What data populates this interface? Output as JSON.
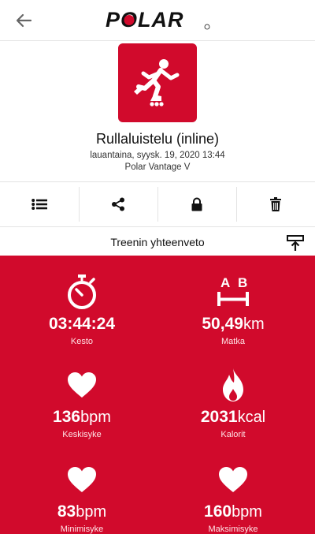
{
  "brand": {
    "logo_text": "POLAR"
  },
  "workout": {
    "sport": "Rullaluistelu (inline)",
    "date": "lauantaina, syysk. 19, 2020 13:44",
    "device": "Polar Vantage V"
  },
  "actions": [
    {
      "name": "list",
      "icon": "list-icon"
    },
    {
      "name": "share",
      "icon": "share-icon"
    },
    {
      "name": "privacy",
      "icon": "lock-icon"
    },
    {
      "name": "delete",
      "icon": "trash-icon"
    }
  ],
  "summary": {
    "title": "Treenin yhteenveto",
    "stats": {
      "duration": {
        "value": "03:44:24",
        "unit": "",
        "label": "Kesto",
        "icon": "stopwatch-icon"
      },
      "distance": {
        "value": "50,49",
        "unit": "km",
        "label": "Matka",
        "icon": "distance-ab-icon",
        "icon_letters": [
          "A",
          "B"
        ]
      },
      "avg_hr": {
        "value": "136",
        "unit": "bpm",
        "label": "Keskisyke",
        "icon": "heart-icon"
      },
      "calories": {
        "value": "2031",
        "unit": "kcal",
        "label": "Kalorit",
        "icon": "flame-icon"
      },
      "min_hr": {
        "value": "83",
        "unit": "bpm",
        "label": "Minimisyke",
        "icon": "heart-icon"
      },
      "max_hr": {
        "value": "160",
        "unit": "bpm",
        "label": "Maksimisyke",
        "icon": "heart-icon"
      }
    }
  },
  "colors": {
    "accent": "#d10a2c",
    "panel_text": "#ffffff"
  }
}
